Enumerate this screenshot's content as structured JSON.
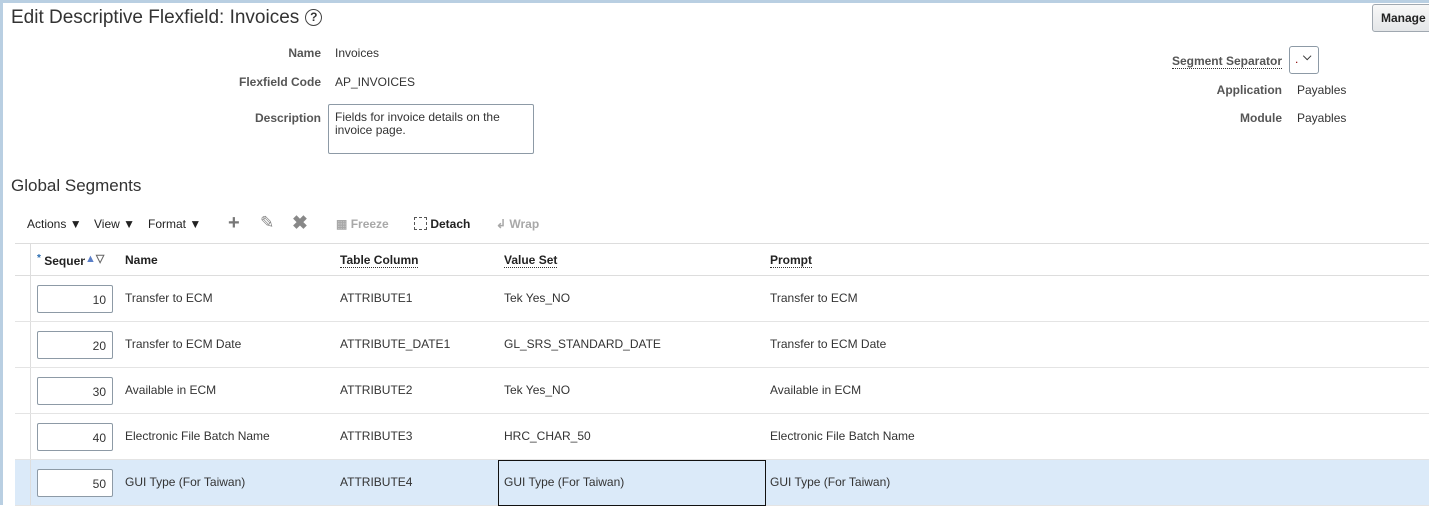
{
  "page": {
    "title": "Edit Descriptive Flexfield: Invoices",
    "help": "?",
    "manage_label": "Manage"
  },
  "form": {
    "name_label": "Name",
    "name": "Invoices",
    "code_label": "Flexfield Code",
    "code": "AP_INVOICES",
    "description_label": "Description",
    "description": "Fields for invoice details on the invoice page.",
    "separator_label": "Segment Separator",
    "separator": ".",
    "application_label": "Application",
    "application": "Payables",
    "module_label": "Module",
    "module": "Payables"
  },
  "section": {
    "title": "Global Segments"
  },
  "toolbar": {
    "actions": "Actions",
    "view": "View",
    "format": "Format",
    "freeze": "Freeze",
    "detach": "Detach",
    "wrap": "Wrap"
  },
  "table": {
    "headers": {
      "sequence": "Sequence",
      "name": "Name",
      "column": "Table Column",
      "valueset": "Value Set",
      "prompt": "Prompt"
    },
    "rows": [
      {
        "seq": "10",
        "name": "Transfer to ECM",
        "column": "ATTRIBUTE1",
        "valueset": "Tek Yes_NO",
        "prompt": "Transfer to ECM"
      },
      {
        "seq": "20",
        "name": "Transfer to ECM Date",
        "column": "ATTRIBUTE_DATE1",
        "valueset": "GL_SRS_STANDARD_DATE",
        "prompt": "Transfer to ECM Date"
      },
      {
        "seq": "30",
        "name": "Available in ECM",
        "column": "ATTRIBUTE2",
        "valueset": "Tek Yes_NO",
        "prompt": "Available in ECM"
      },
      {
        "seq": "40",
        "name": "Electronic File Batch Name",
        "column": "ATTRIBUTE3",
        "valueset": "HRC_CHAR_50",
        "prompt": "Electronic File Batch Name"
      },
      {
        "seq": "50",
        "name": "GUI Type (For Taiwan)",
        "column": "ATTRIBUTE4",
        "valueset": "GUI Type (For Taiwan)",
        "prompt": "GUI Type (For Taiwan)"
      }
    ]
  }
}
